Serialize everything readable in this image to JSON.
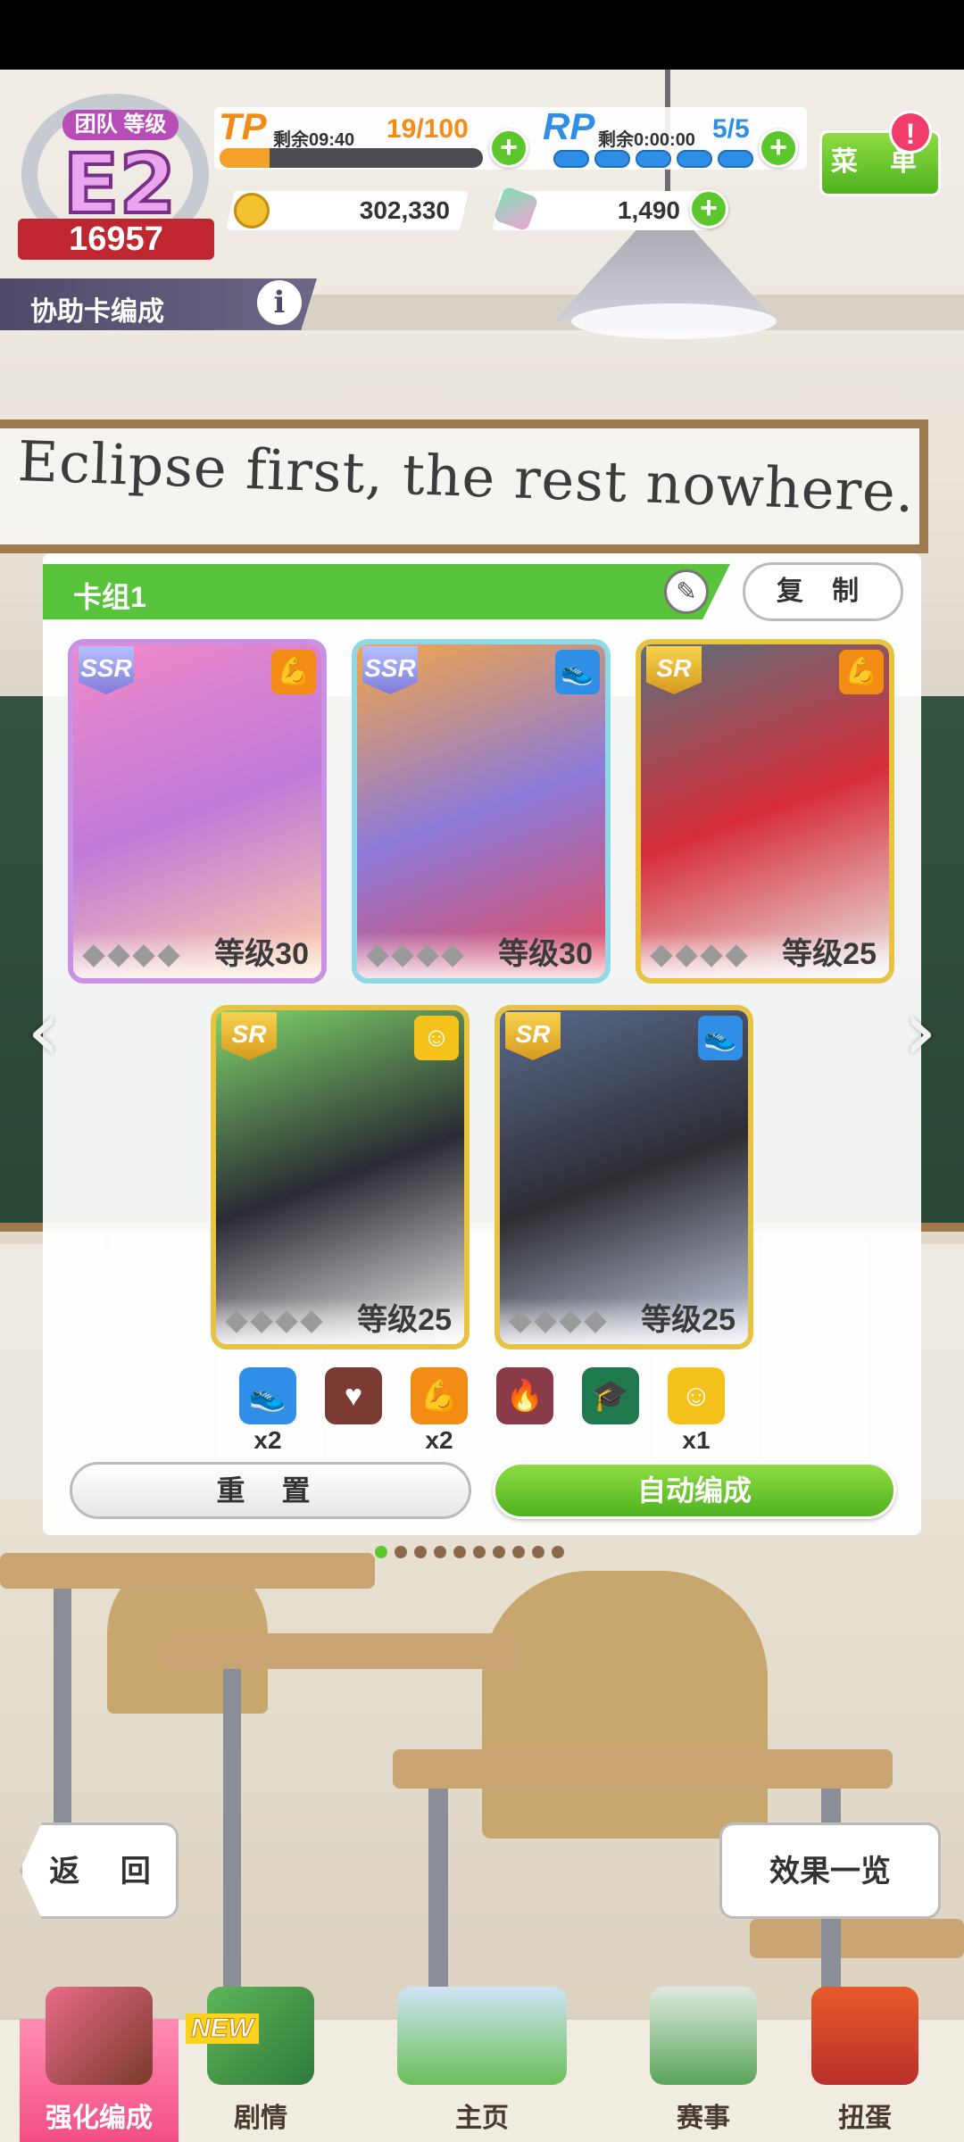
{
  "hud": {
    "rank": {
      "label": "团队 等级",
      "grade": "E2",
      "score": "16957"
    },
    "tp": {
      "label": "TP",
      "timer": "剩余09:40",
      "value": "19/100",
      "progress_pct": 19
    },
    "rp": {
      "label": "RP",
      "timer": "剩余0:00:00",
      "value": "5/5",
      "pips": 5
    },
    "currency": {
      "coins": "302,330",
      "gems": "1,490"
    },
    "menu_label": "菜 单",
    "menu_badge": "!"
  },
  "subtitle": {
    "title": "协助卡编成",
    "info": "i"
  },
  "background": {
    "banner_text": "Eclipse first, the rest nowhere."
  },
  "deck": {
    "title": "卡组1",
    "copy_label": "复 制",
    "cards": [
      {
        "rarity": "SSR",
        "type": "power-icon",
        "level": "等级30",
        "art_colors": [
          "#f08ac8",
          "#c07ad8",
          "#ffd2a8"
        ]
      },
      {
        "rarity": "SSR",
        "type": "speed-icon",
        "level": "等级30",
        "art_colors": [
          "#f2a64a",
          "#8c7ad8",
          "#e84a5a"
        ]
      },
      {
        "rarity": "SR",
        "type": "power-icon",
        "level": "等级25",
        "art_colors": [
          "#5c6f7a",
          "#d62e3a",
          "#eaeaea"
        ]
      },
      {
        "rarity": "SR",
        "type": "friend-icon",
        "level": "等级25",
        "art_colors": [
          "#7fd36a",
          "#2a2a33",
          "#f2f2f2"
        ]
      },
      {
        "rarity": "SR",
        "type": "speed-icon",
        "level": "等级25",
        "art_colors": [
          "#5a6a8c",
          "#2d2d33",
          "#c7cfe0"
        ]
      }
    ],
    "types": [
      {
        "name": "speed-icon",
        "color": "#2f8fe6",
        "count": "x2"
      },
      {
        "name": "stamina-icon",
        "color": "#7a3b32",
        "count": ""
      },
      {
        "name": "power-icon",
        "color": "#f28c14",
        "count": "x2"
      },
      {
        "name": "guts-icon",
        "color": "#8a3b4a",
        "count": ""
      },
      {
        "name": "wisdom-icon",
        "color": "#1f7a4f",
        "count": ""
      },
      {
        "name": "friend-icon",
        "color": "#f5c21c",
        "count": "x1"
      }
    ],
    "reset_label": "重 置",
    "auto_label": "自动编成",
    "pages": 10,
    "active_page": 0
  },
  "footer": {
    "back_label": "返 回",
    "effects_label": "效果一览"
  },
  "nav": {
    "items": [
      {
        "label": "强化编成",
        "active": true
      },
      {
        "label": "剧情",
        "active": false,
        "badge": "NEW"
      },
      {
        "label": "主页",
        "active": false
      },
      {
        "label": "赛事",
        "active": false
      },
      {
        "label": "扭蛋",
        "active": false
      }
    ]
  }
}
